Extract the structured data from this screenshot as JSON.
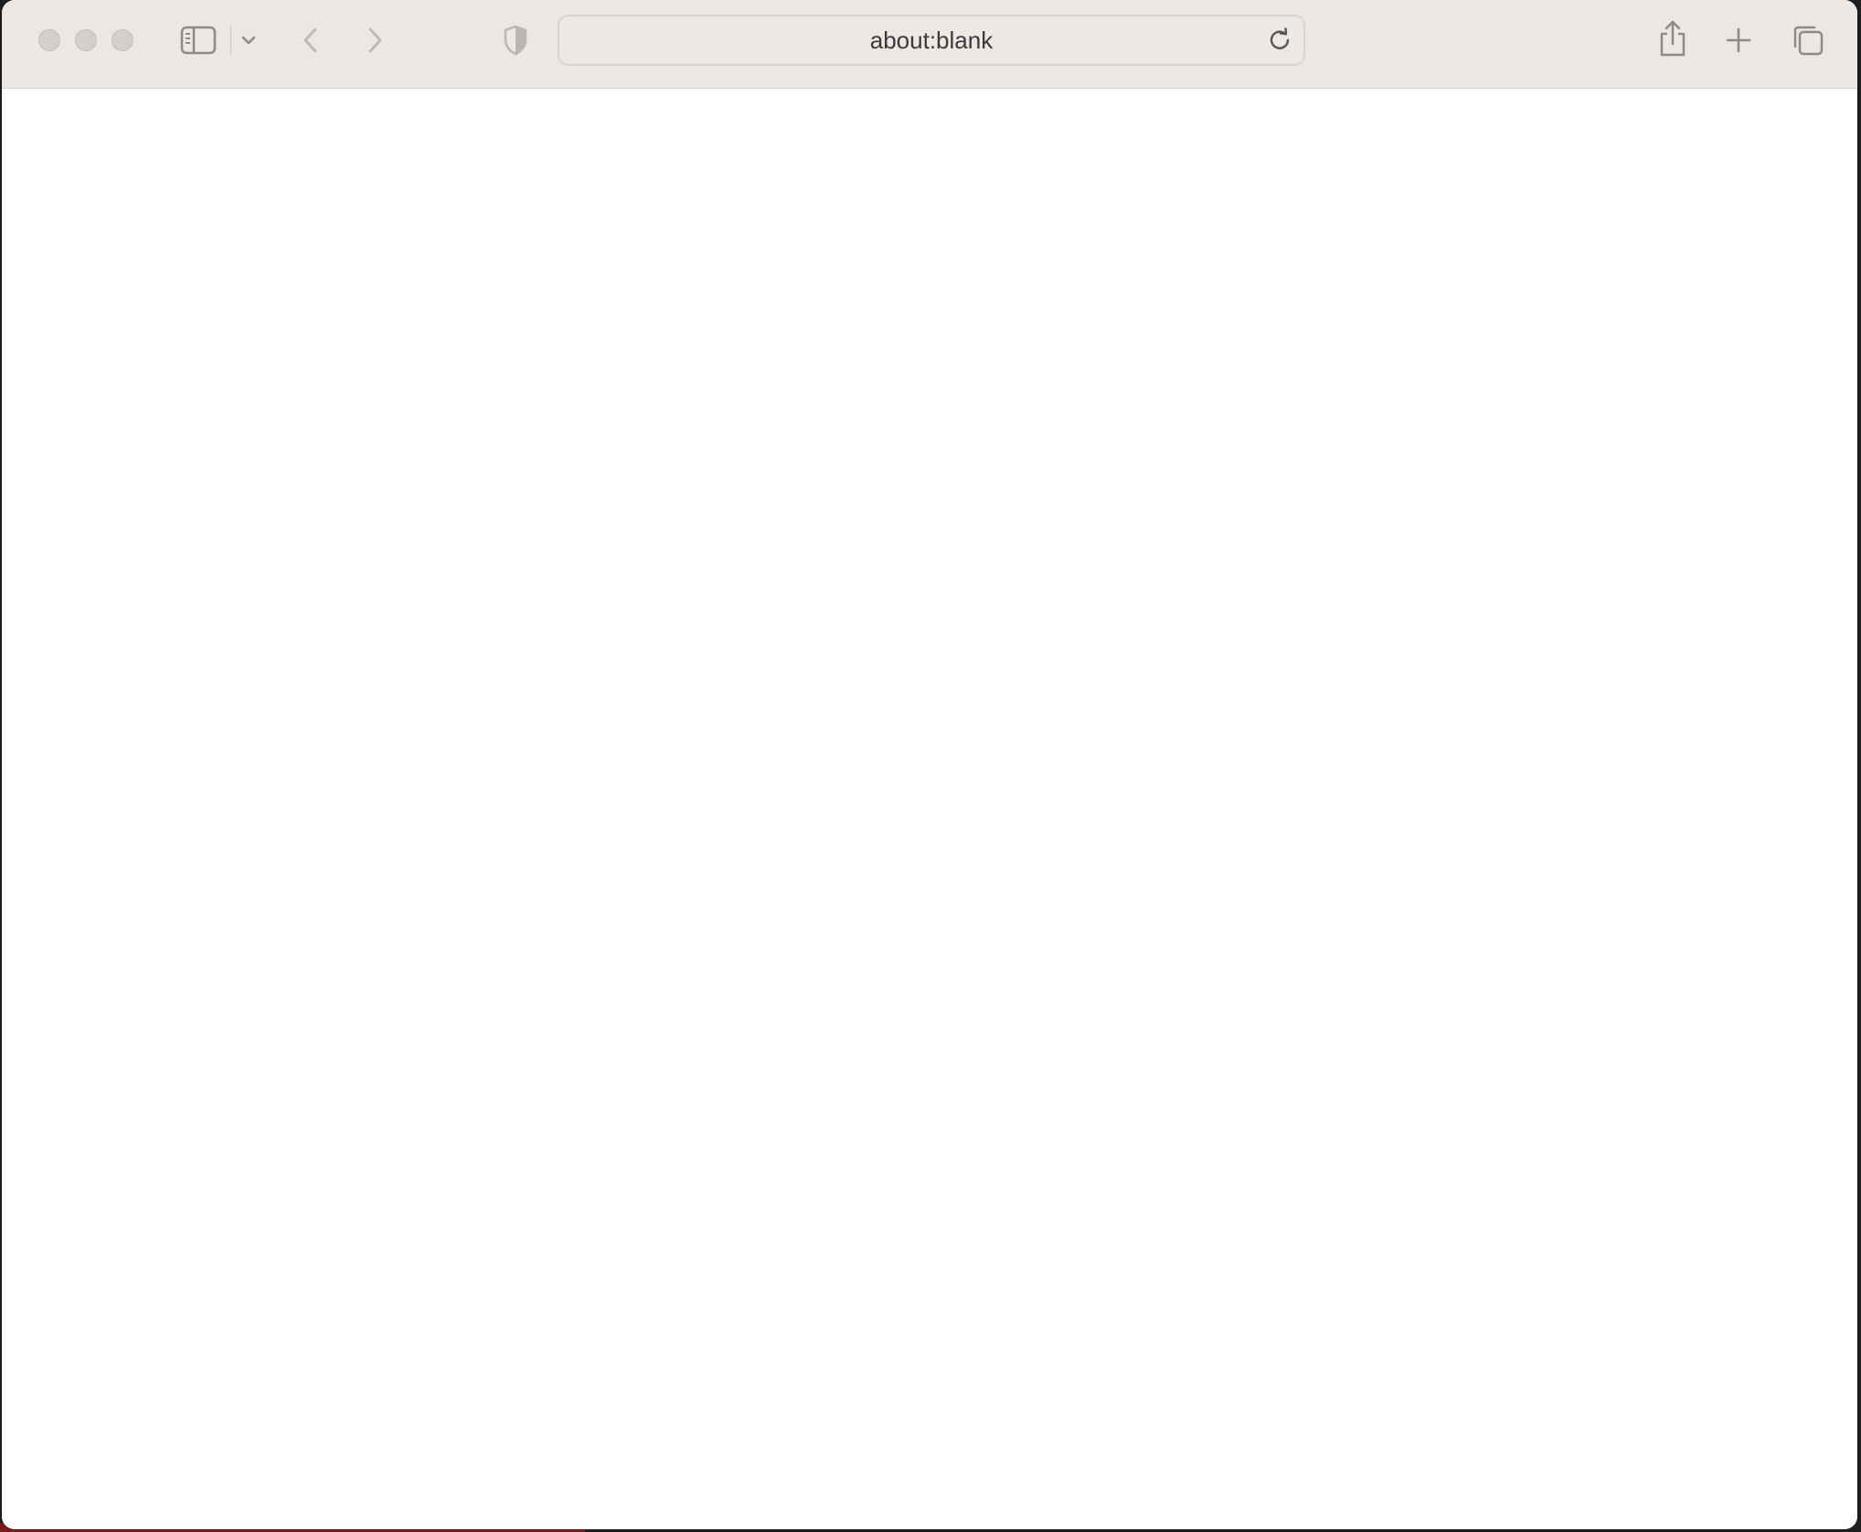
{
  "browser": {
    "address_bar": {
      "url": "about:blank"
    },
    "icons": [
      "close-icon",
      "minimize-icon",
      "zoom-icon",
      "sidebar-icon",
      "chevron-down-icon",
      "back-icon",
      "forward-icon",
      "shield-icon",
      "reload-icon",
      "share-icon",
      "new-tab-icon",
      "tab-overview-icon"
    ]
  },
  "colors": {
    "toolbar_bg": "#ece7e4",
    "icon_color": "#9c9896",
    "content_bg": "#ffffff"
  }
}
